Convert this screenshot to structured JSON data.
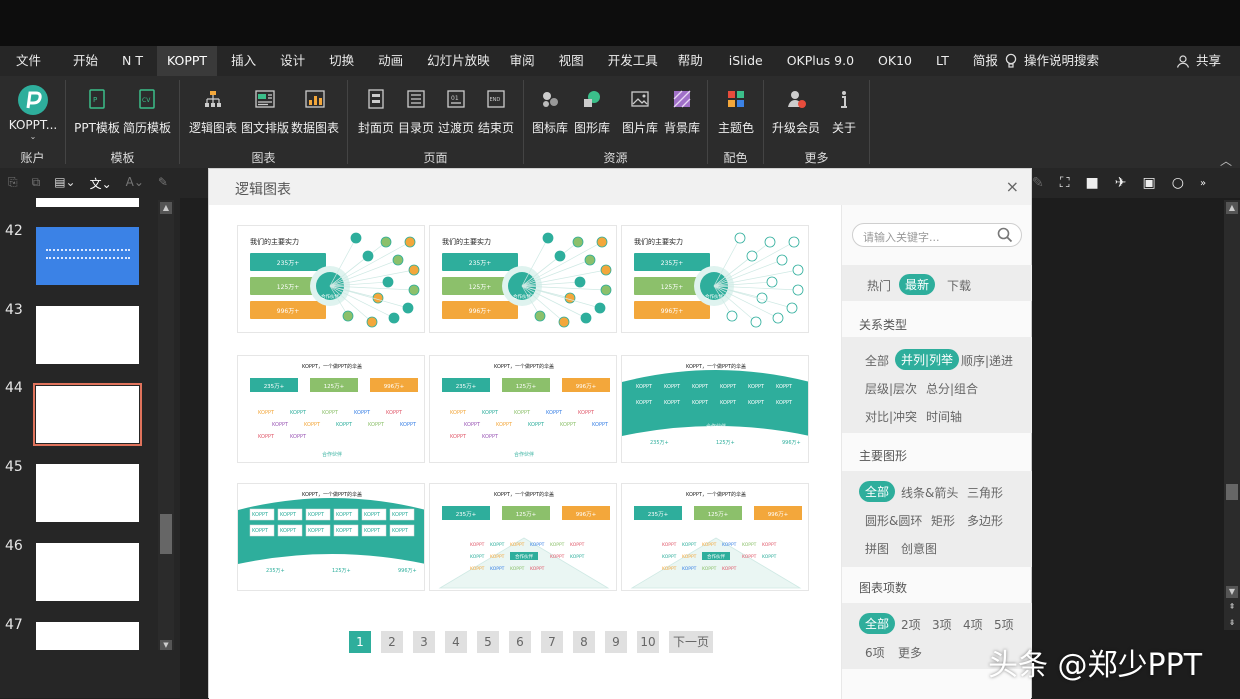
{
  "menu": {
    "tabs": [
      "文件",
      "开始",
      "N T",
      "KOPPT",
      "插入",
      "设计",
      "切换",
      "动画",
      "幻灯片放映",
      "审阅",
      "视图",
      "开发工具",
      "帮助",
      "iSlide",
      "OKPlus 9.0",
      "OK10",
      "LT",
      "简报"
    ],
    "active_tab": "KOPPT",
    "search_label": "操作说明搜索",
    "share_label": "共享"
  },
  "ribbon": {
    "account": {
      "button": "KOPPT...",
      "group": "账户"
    },
    "template": {
      "group": "模板",
      "buttons": [
        "PPT模板",
        "简历模板"
      ]
    },
    "chart": {
      "group": "图表",
      "buttons": [
        "逻辑图表",
        "图文排版",
        "数据图表"
      ]
    },
    "page": {
      "group": "页面",
      "buttons": [
        "封面页",
        "目录页",
        "过渡页",
        "结束页"
      ]
    },
    "resource": {
      "group": "资源",
      "buttons": [
        "图标库",
        "图形库",
        "图片库",
        "背景库"
      ]
    },
    "color": {
      "group": "配色",
      "buttons": [
        "主题色"
      ]
    },
    "more": {
      "group": "更多",
      "buttons": [
        "升级会员",
        "关于"
      ]
    }
  },
  "slides": {
    "numbers": [
      "42",
      "43",
      "44",
      "45",
      "46",
      "47"
    ],
    "selected": "44"
  },
  "dialog": {
    "title": "逻辑图表",
    "close": "×",
    "search_placeholder": "请输入关键字...",
    "sort_tabs": [
      "热门",
      "最新",
      "下载"
    ],
    "sort_active": "最新",
    "relation": {
      "title": "关系类型",
      "options": [
        "全部",
        "并列|列举",
        "顺序|递进",
        "层级|层次",
        "总分|组合",
        "对比|冲突",
        "时间轴"
      ],
      "active": "并列|列举"
    },
    "shape": {
      "title": "主要图形",
      "options": [
        "全部",
        "线条&箭头",
        "三角形",
        "圆形&圆环",
        "矩形",
        "多边形",
        "拼图",
        "创意图"
      ],
      "active": "全部"
    },
    "items": {
      "title": "图表项数",
      "options": [
        "全部",
        "2项",
        "3项",
        "4项",
        "5项",
        "6项",
        "更多"
      ],
      "active": "全部"
    },
    "pager": {
      "pages": [
        "1",
        "2",
        "3",
        "4",
        "5",
        "6",
        "7",
        "8",
        "9",
        "10"
      ],
      "active": "1",
      "next": "下一页"
    },
    "cards": [
      {
        "title": "我们的主要实力",
        "center": "合作伙伴",
        "stats": [
          "235万+",
          "125万+",
          "996万+"
        ]
      },
      {
        "title": "我们的主要实力",
        "center": "合作伙伴",
        "stats": [
          "235万+",
          "125万+",
          "996万+"
        ]
      },
      {
        "title": "我们的主要实力",
        "center": "合作伙伴",
        "stats": [
          "235万+",
          "125万+",
          "996万+"
        ]
      },
      {
        "title": "KOPPT，一个做PPT的伞盖",
        "center": "合作伙伴",
        "stats": [
          "235万+",
          "125万+",
          "996万+"
        ]
      },
      {
        "title": "KOPPT，一个做PPT的伞盖",
        "center": "合作伙伴",
        "stats": [
          "235万+",
          "125万+",
          "996万+"
        ]
      },
      {
        "title": "KOPPT，一个做PPT的伞盖",
        "center": "合作伙伴",
        "stats": [
          "235万+",
          "125万+",
          "996万+"
        ]
      },
      {
        "title": "KOPPT，一个做PPT的伞盖",
        "center": "",
        "stats": [
          "235万+",
          "125万+",
          "996万+"
        ]
      },
      {
        "title": "KOPPT，一个做PPT的伞盖",
        "center": "合作伙伴",
        "stats": [
          "235万+",
          "125万+",
          "996万+"
        ]
      },
      {
        "title": "KOPPT，一个做PPT的伞盖",
        "center": "合作伙伴",
        "stats": [
          "235万+",
          "125万+",
          "996万+"
        ]
      }
    ],
    "card_word": "KOPPT"
  },
  "watermark": "头条 @郑少PPT",
  "colors": {
    "teal": "#2eae9c",
    "green": "#8cc06b",
    "orange": "#f3a73b",
    "blue": "#3b82e6"
  }
}
